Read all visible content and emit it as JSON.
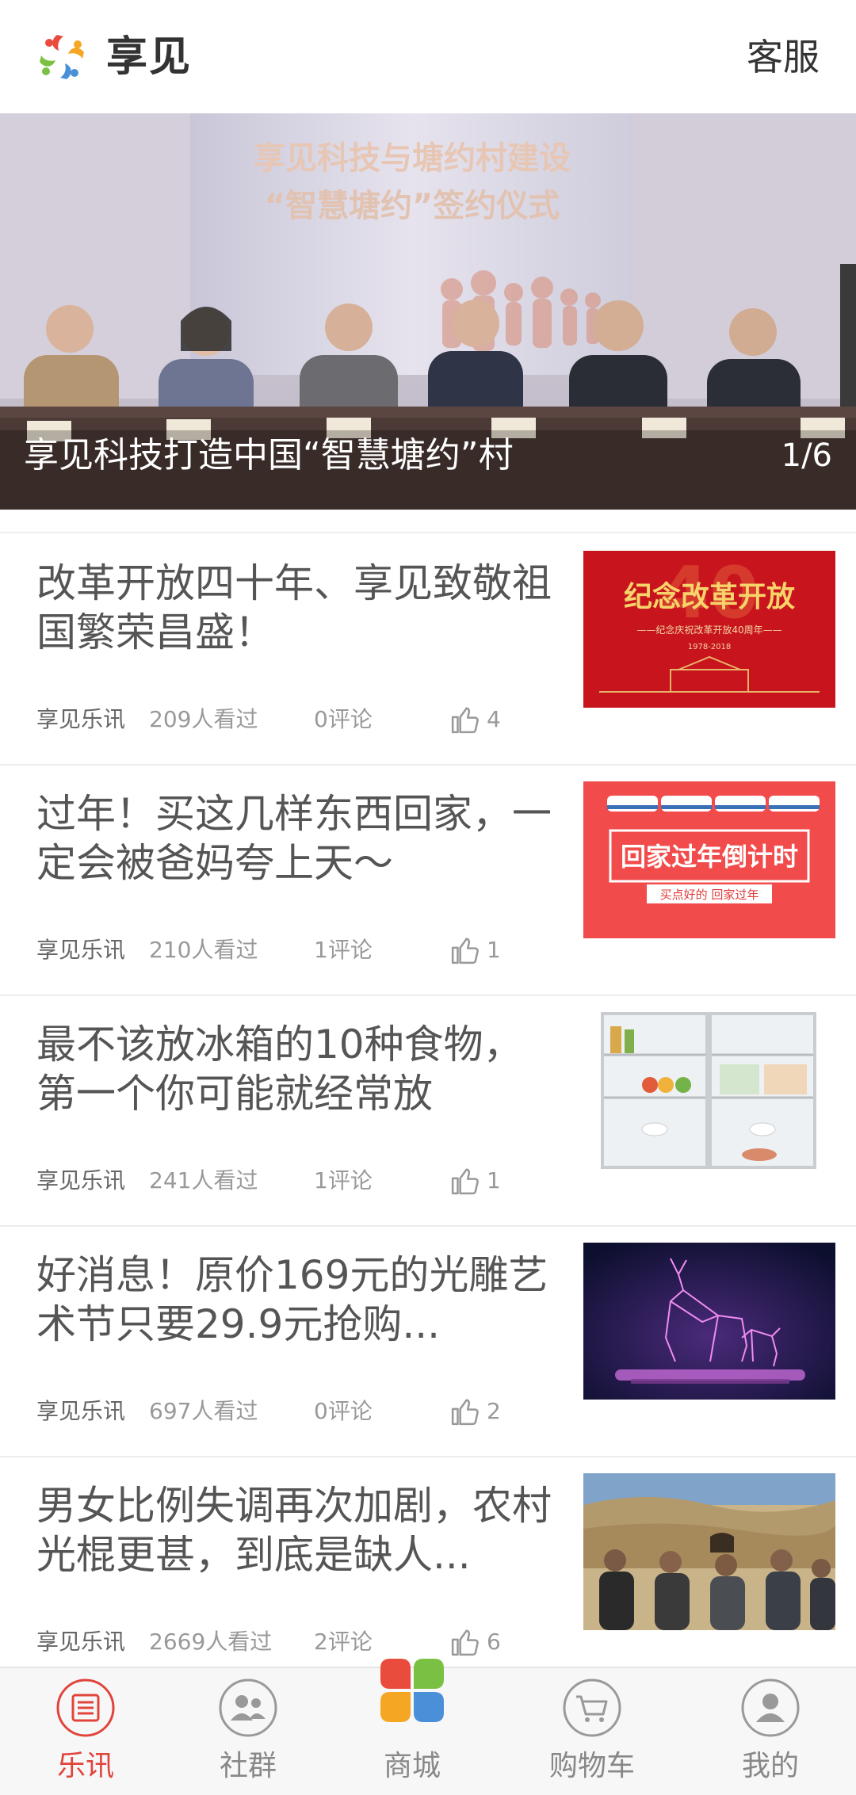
{
  "header": {
    "app_name": "享见",
    "service_label": "客服"
  },
  "banner": {
    "caption": "享见科技打造中国“智慧塘约”村",
    "counter": "1/6",
    "slide_text_line1": "享见科技与塘约村建设",
    "slide_text_line2": "“智慧塘约”签约仪式"
  },
  "news": [
    {
      "title": "改革开放四十年、享见致敬祖国繁荣昌盛！",
      "source": "享见乐讯",
      "views": "209人看过",
      "comments": "0评论",
      "likes": "4",
      "thumb": {
        "line1": "纪念改革开放",
        "line2": "——纪念庆祝改革开放40周年——",
        "line3": "1978-2018",
        "big": "40"
      }
    },
    {
      "title": "过年！买这几样东西回家，一定会被爸妈夸上天～",
      "source": "享见乐讯",
      "views": "210人看过",
      "comments": "1评论",
      "likes": "1",
      "thumb": {
        "line1": "回家过年倒计时",
        "line2": "买点好的  回家过年"
      }
    },
    {
      "title": "最不该放冰箱的10种食物，第一个你可能就经常放",
      "source": "享见乐讯",
      "views": "241人看过",
      "comments": "1评论",
      "likes": "1"
    },
    {
      "title": "好消息！原价169元的光雕艺术节只要29.9元抢购...",
      "source": "享见乐讯",
      "views": "697人看过",
      "comments": "0评论",
      "likes": "2"
    },
    {
      "title": "男女比例失调再次加剧，农村光棍更甚，到底是缺人...",
      "source": "享见乐讯",
      "views": "2669人看过",
      "comments": "2评论",
      "likes": "6"
    }
  ],
  "nav": [
    {
      "label": "乐讯",
      "icon": "news-icon",
      "active": true
    },
    {
      "label": "社群",
      "icon": "community-icon",
      "active": false
    },
    {
      "label": "商城",
      "icon": "mall-icon",
      "active": false
    },
    {
      "label": "购物车",
      "icon": "cart-icon",
      "active": false
    },
    {
      "label": "我的",
      "icon": "profile-icon",
      "active": false
    }
  ],
  "colors": {
    "accent": "#e0443b",
    "text": "#555555",
    "meta": "#999999"
  }
}
